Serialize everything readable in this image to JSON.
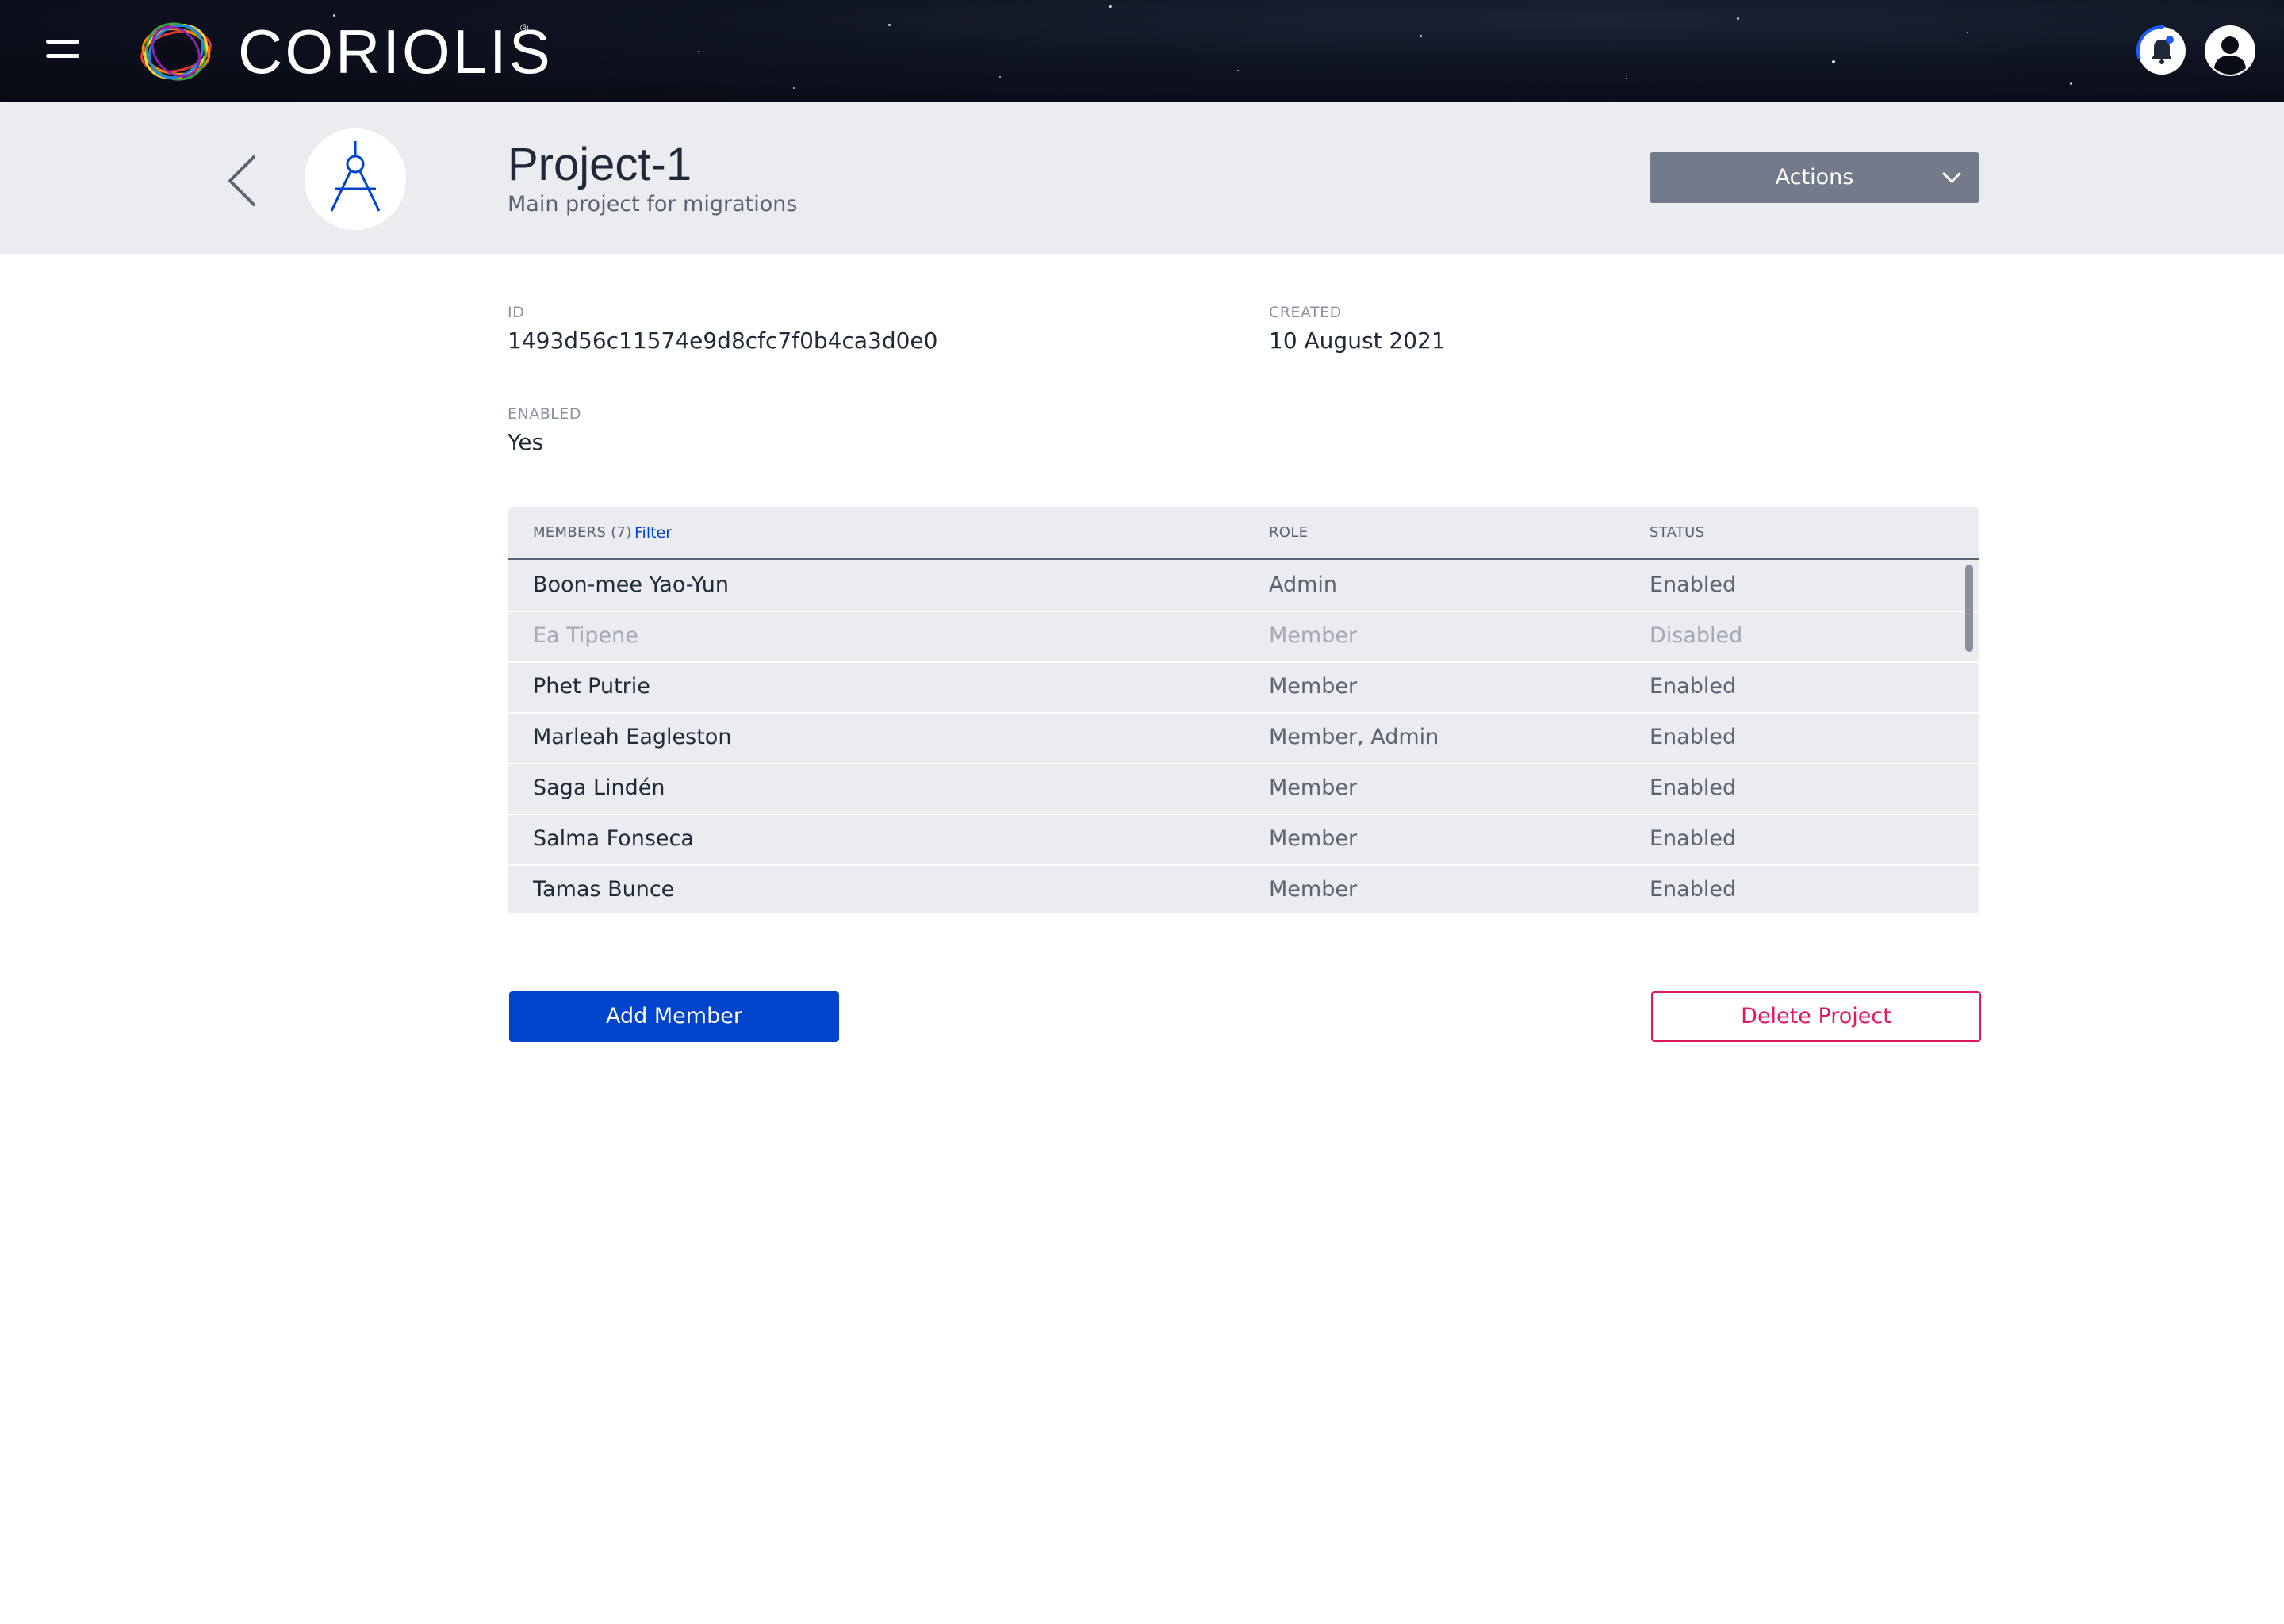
{
  "app": {
    "brand": "CORIOLIS",
    "brand_reg_mark": "®",
    "icons": {
      "menu": "hamburger-menu-icon",
      "logo": "coriolis-logo-icon",
      "notifications": "notification-bell-icon",
      "user": "user-avatar-icon"
    }
  },
  "header": {
    "project_title": "Project-1",
    "project_description": "Main project for migrations",
    "project_icon": "compass-icon",
    "actions_label": "Actions"
  },
  "details": {
    "id_label": "ID",
    "id_value": "1493d56c11574e9d8cfc7f0b4ca3d0e0",
    "created_label": "CREATED",
    "created_value": "10 August 2021",
    "enabled_label": "ENABLED",
    "enabled_value": "Yes"
  },
  "members": {
    "header_members": "MEMBERS (7)",
    "header_filter": "Filter",
    "header_role": "ROLE",
    "header_status": "STATUS",
    "rows": [
      {
        "name": "Boon-mee Yao-Yun",
        "role": "Admin",
        "status": "Enabled"
      },
      {
        "name": "Ea Tipene",
        "role": "Member",
        "status": "Disabled"
      },
      {
        "name": "Phet Putrie",
        "role": "Member",
        "status": "Enabled"
      },
      {
        "name": "Marleah Eagleston",
        "role": "Member, Admin",
        "status": "Enabled"
      },
      {
        "name": "Saga Lindén",
        "role": "Member",
        "status": "Enabled"
      },
      {
        "name": "Salma Fonseca",
        "role": "Member",
        "status": "Enabled"
      },
      {
        "name": "Tamas Bunce",
        "role": "Member",
        "status": "Enabled"
      }
    ]
  },
  "footer": {
    "add_member_label": "Add Member",
    "delete_project_label": "Delete Project"
  },
  "colors": {
    "primary": "#0044cc",
    "danger": "#e0195f",
    "header_band": "#eaecf0",
    "actions_button": "#737a8a"
  }
}
